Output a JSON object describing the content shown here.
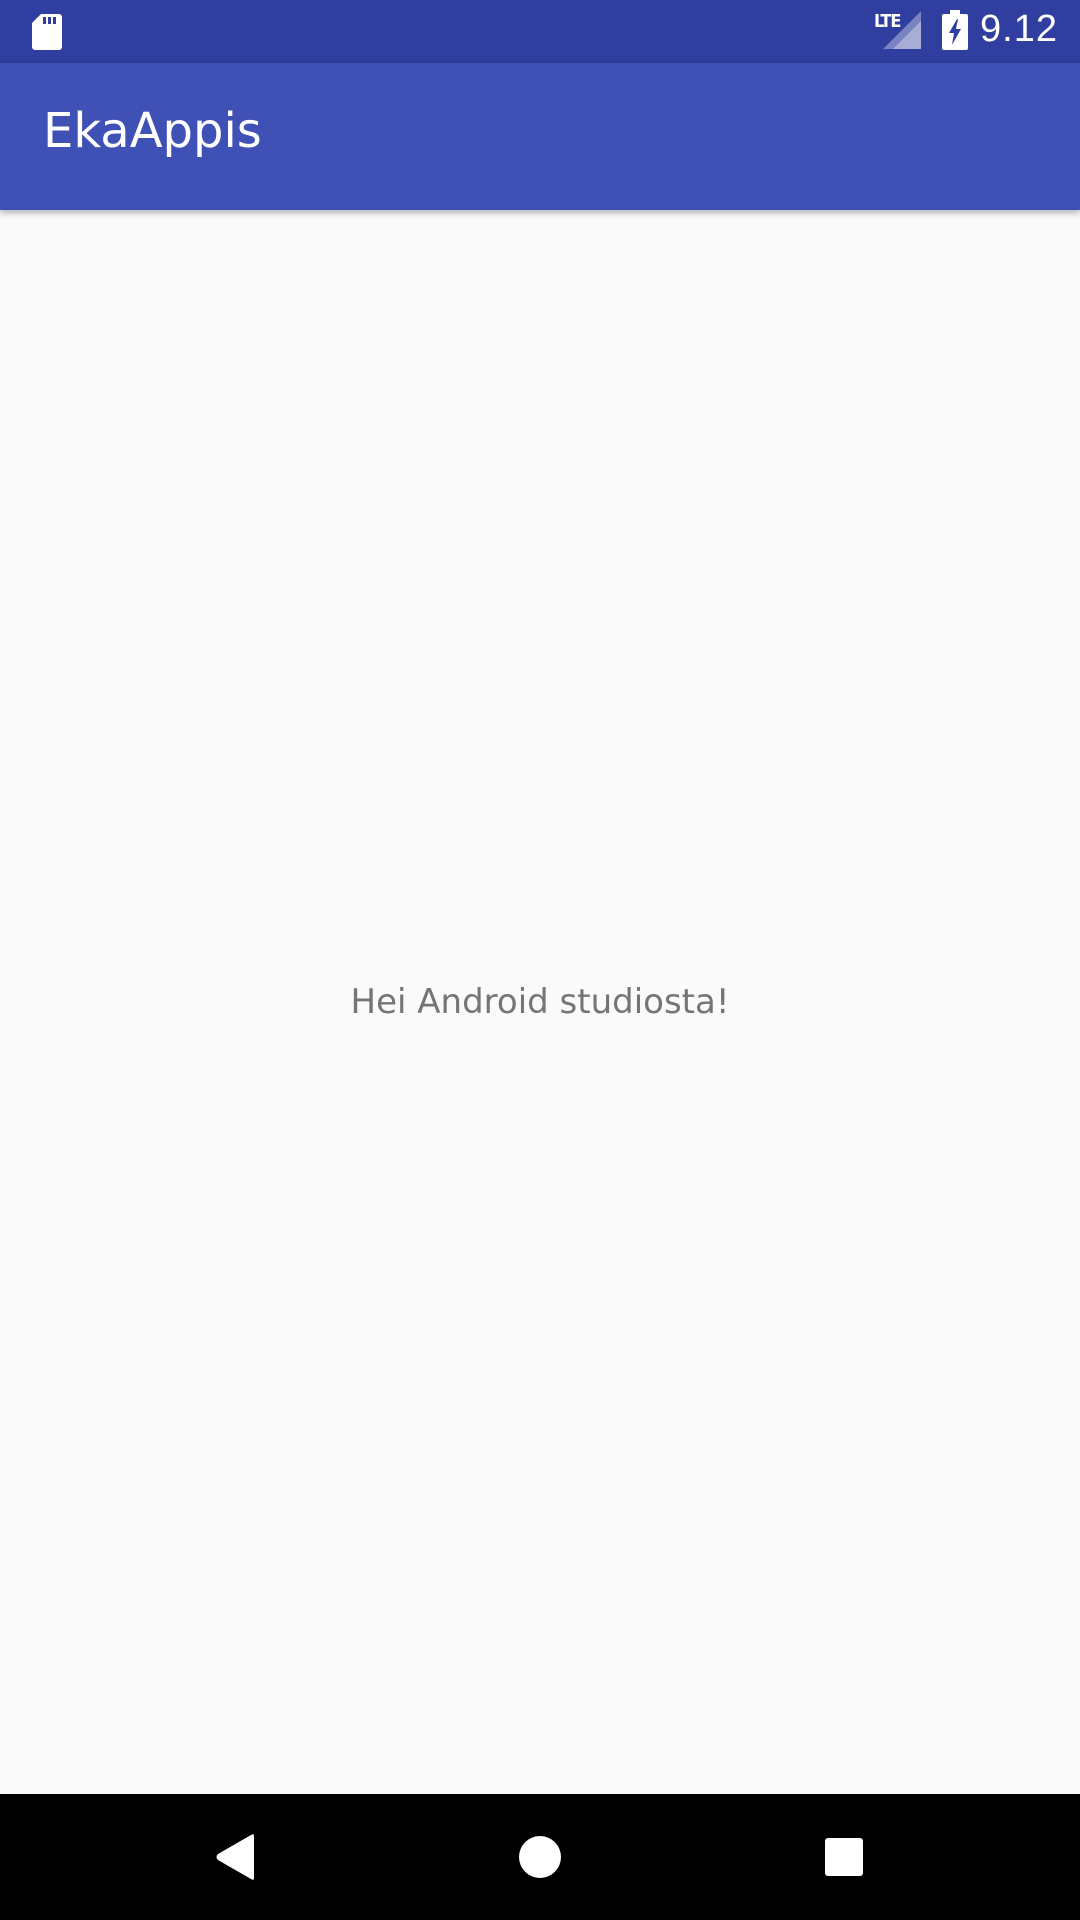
{
  "status_bar": {
    "network_label": "LTE",
    "time": "9.12",
    "icons": [
      "sd-card-icon",
      "signal-icon",
      "battery-charging-icon"
    ]
  },
  "app_bar": {
    "title": "EkaAppis"
  },
  "main": {
    "message": "Hei Android studiosta!"
  },
  "nav_bar": {
    "buttons": [
      "back",
      "home",
      "recents"
    ]
  },
  "colors": {
    "status_bar": "#303f9f",
    "app_bar": "#3f51b5",
    "background": "#fafafa",
    "message_text": "#757575",
    "nav_bar": "#000000"
  }
}
